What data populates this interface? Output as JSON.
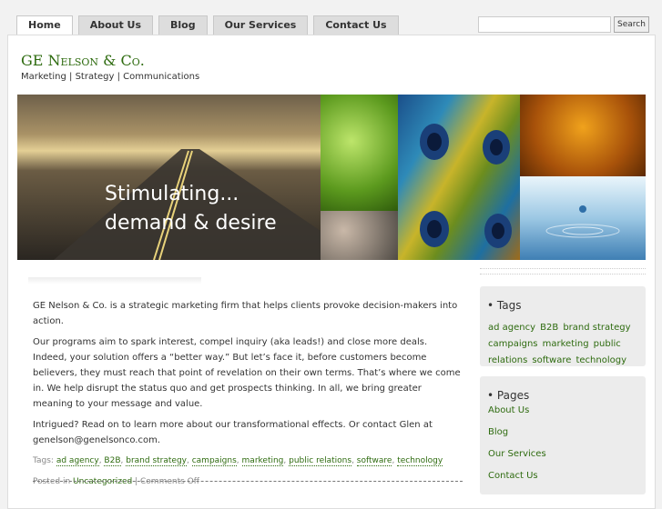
{
  "nav": {
    "tabs": [
      "Home",
      "About Us",
      "Blog",
      "Our Services",
      "Contact Us"
    ]
  },
  "search": {
    "button_label": "Search",
    "value": ""
  },
  "header": {
    "title": "GE Nelson & Co.",
    "description": "Marketing | Strategy | Communications"
  },
  "banner": {
    "line1": "Stimulating...",
    "line2": "demand & desire"
  },
  "post": {
    "paragraphs": [
      "GE Nelson & Co. is a strategic marketing firm that helps clients provoke decision-makers into action.",
      "Our programs aim to spark interest, compel inquiry (aka leads!) and close more deals. Indeed, your solution offers a “better way.” But let’s face it, before customers become believers, they must reach that point of revelation on their own terms. That’s where we come in. We help disrupt the status quo and get prospects thinking. In all, we bring greater meaning to your message and value.",
      "Intrigued? Read on to learn more about our transformational effects. Or contact Glen at genelson@genelsonco.com."
    ],
    "tags_label": "Tags:",
    "tags": [
      "ad agency",
      "B2B",
      "brand strategy",
      "campaigns",
      "marketing",
      "public relations",
      "software",
      "technology"
    ],
    "posted_label": "Posted in",
    "category": "Uncategorized",
    "comments": "Comments Off"
  },
  "sidebar": {
    "tags_title": "Tags",
    "tag_cloud": [
      "ad agency",
      "B2B",
      "brand strategy",
      "campaigns",
      "marketing",
      "public relations",
      "software",
      "technology"
    ],
    "pages_title": "Pages",
    "pages": [
      "About Us",
      "Blog",
      "Our Services",
      "Contact Us"
    ]
  },
  "colors": {
    "link": "#2e6b0f",
    "page_bg": "#f2f2f2",
    "widget_bg": "#ececec"
  }
}
